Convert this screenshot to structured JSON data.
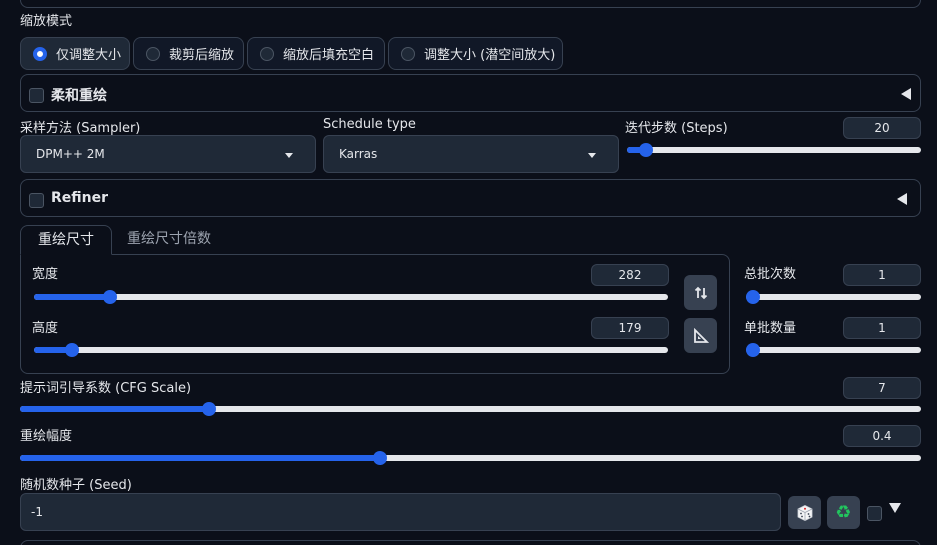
{
  "resize_mode": {
    "label": "缩放模式",
    "options": [
      {
        "label": "仅调整大小",
        "selected": true
      },
      {
        "label": "裁剪后缩放",
        "selected": false
      },
      {
        "label": "缩放后填充空白",
        "selected": false
      },
      {
        "label": "调整大小 (潜空间放大)",
        "selected": false
      }
    ]
  },
  "soft_inpaint": {
    "title": "柔和重绘",
    "checked": false
  },
  "sampler": {
    "label": "采样方法 (Sampler)",
    "value": "DPM++ 2M"
  },
  "schedule": {
    "label": "Schedule type",
    "value": "Karras"
  },
  "steps": {
    "label": "迭代步数 (Steps)",
    "value": "20",
    "fraction": 0.065
  },
  "refiner": {
    "title": "Refiner",
    "checked": false
  },
  "tabs": [
    {
      "label": "重绘尺寸",
      "active": true
    },
    {
      "label": "重绘尺寸倍数",
      "active": false
    }
  ],
  "width": {
    "label": "宽度",
    "value": "282",
    "fraction": 0.12
  },
  "height": {
    "label": "高度",
    "value": "179",
    "fraction": 0.06
  },
  "batch_count": {
    "label": "总批次数",
    "value": "1",
    "fraction": 0.0
  },
  "batch_size": {
    "label": "单批数量",
    "value": "1",
    "fraction": 0.0
  },
  "cfg": {
    "label": "提示词引导系数 (CFG Scale)",
    "value": "7",
    "fraction": 0.21
  },
  "denoise": {
    "label": "重绘幅度",
    "value": "0.4",
    "fraction": 0.4
  },
  "seed": {
    "label": "随机数种子 (Seed)",
    "value": "-1"
  },
  "colors": {
    "accent": "#2563eb",
    "background": "#0b0f19",
    "panel": "#1f2937",
    "border": "#374151"
  }
}
